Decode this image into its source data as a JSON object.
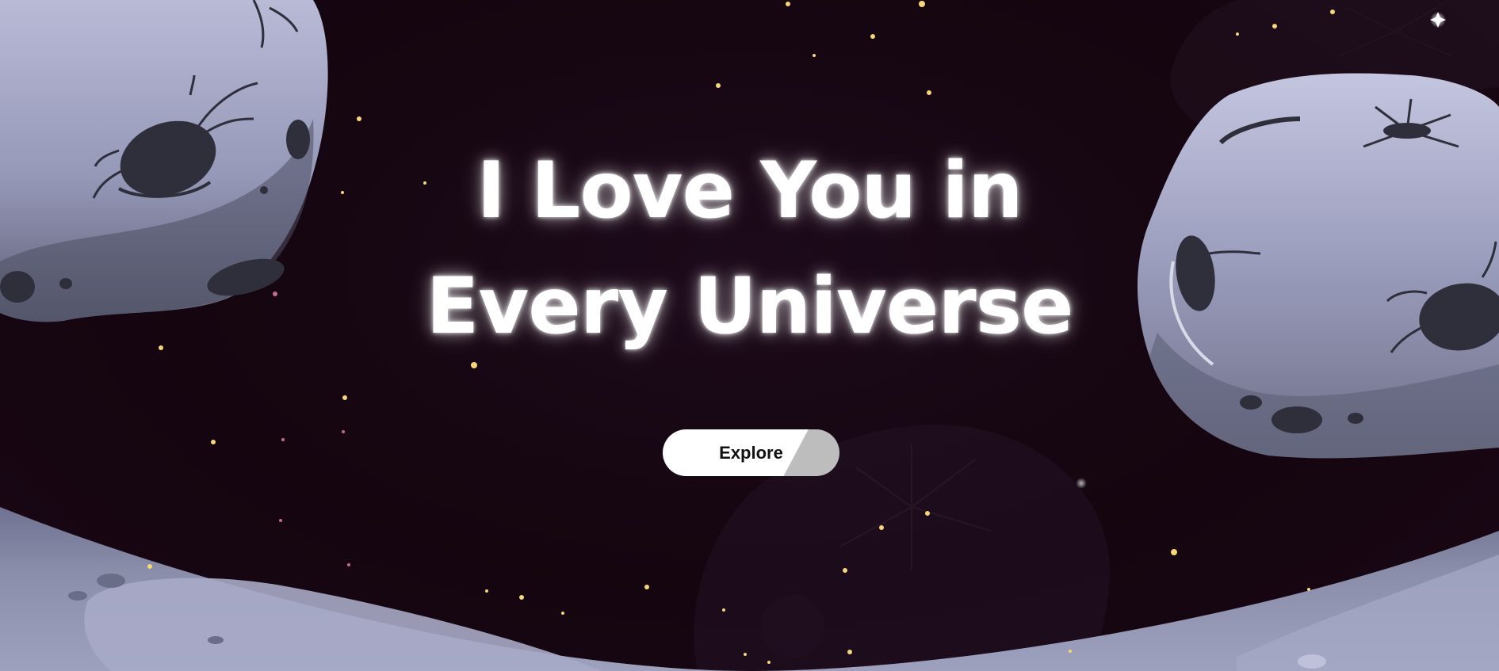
{
  "hero": {
    "title_line_1": "I Love You in",
    "title_line_2": "Every Universe"
  },
  "explore_button": {
    "label": "Explore"
  },
  "colors": {
    "background": "#160812",
    "asteroid_light": "#a4a6c4",
    "asteroid_dark": "#2e2e3a",
    "planet_surface": "#8e91ad",
    "star": "#f5d77a",
    "title_text": "#ffffff",
    "button_bg": "#ffffff"
  },
  "icons": {
    "left_asteroid": "asteroid-illustration",
    "right_asteroid": "asteroid-illustration",
    "background_asteroid": "faded-asteroid-illustration",
    "planet_surface": "planet-surface-illustration",
    "stars": "star-field"
  }
}
